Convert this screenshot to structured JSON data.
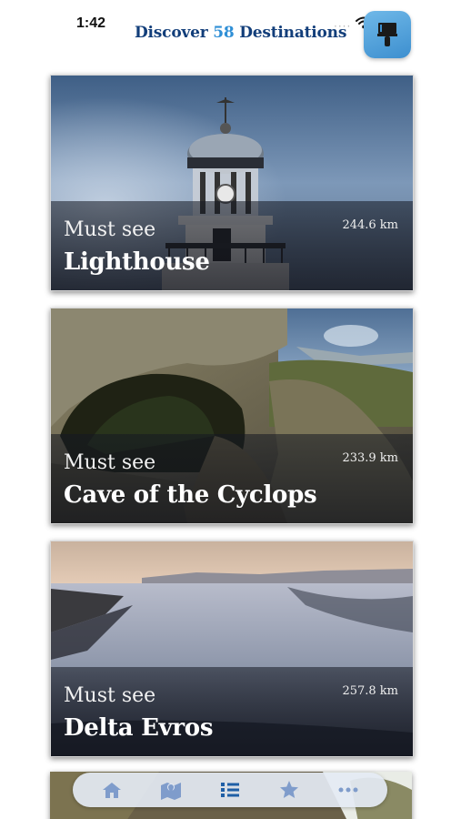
{
  "status_bar": {
    "time": "1:42",
    "more": "····"
  },
  "header": {
    "title_prefix": "Discover",
    "title_number": "58",
    "title_suffix": "Destinations",
    "filter_icon": "brush-icon"
  },
  "destinations": [
    {
      "kicker": "Must see",
      "name": "Lighthouse",
      "distance": "244.6 km"
    },
    {
      "kicker": "Must see",
      "name": "Cave of the Cyclops",
      "distance": "233.9 km"
    },
    {
      "kicker": "Must see",
      "name": "Delta Evros",
      "distance": "257.8 km"
    }
  ],
  "tab_bar": {
    "tabs": [
      {
        "icon": "home-icon",
        "active": false
      },
      {
        "icon": "map-icon",
        "active": false
      },
      {
        "icon": "list-icon",
        "active": true
      },
      {
        "icon": "star-icon",
        "active": false
      },
      {
        "icon": "more-icon",
        "active": false
      }
    ],
    "colors": {
      "active": "#1f5fa6",
      "inactive": "#7f9ccb"
    }
  }
}
